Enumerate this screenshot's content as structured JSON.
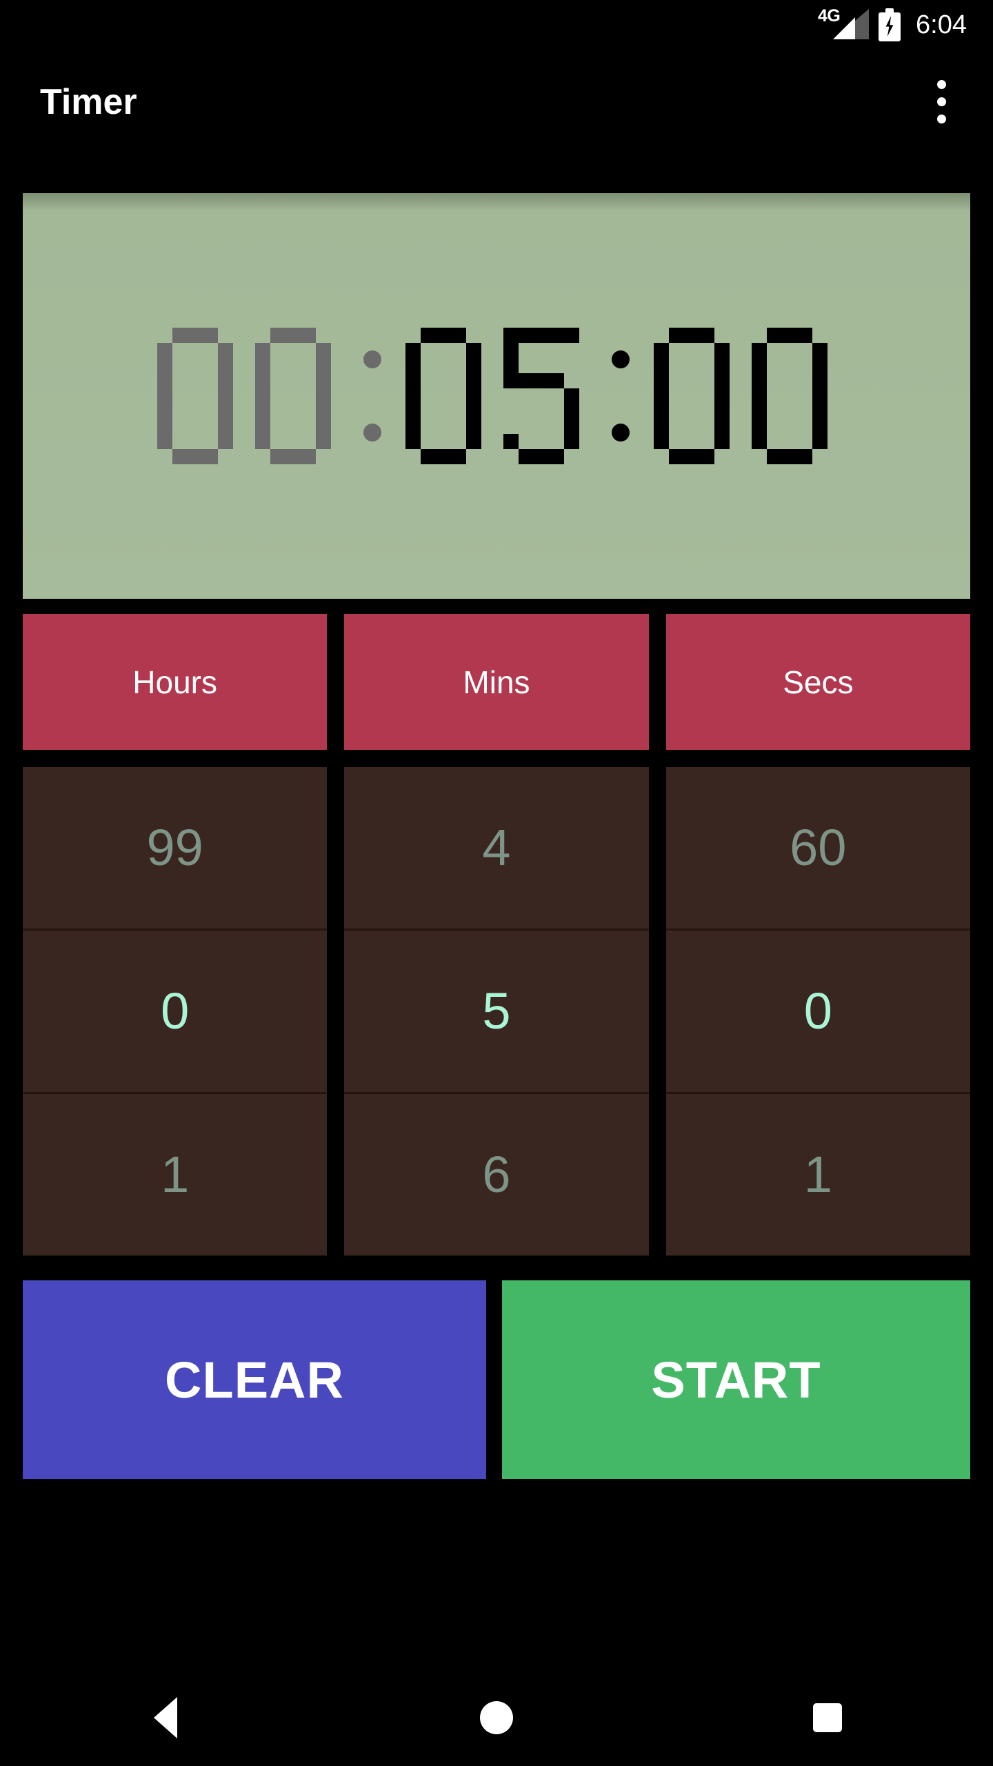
{
  "status_bar": {
    "network_label": "4G",
    "signal_icon": "signal-triangle-icon",
    "battery_icon": "battery-charging-icon",
    "time": "6:04"
  },
  "app_bar": {
    "title": "Timer",
    "overflow_icon": "more-vertical-icon"
  },
  "display": {
    "background_color": "#a6bb9b",
    "active_color": "#000000",
    "inactive_color": "#6b6b6b",
    "hours": "00",
    "mins": "05",
    "secs": "00",
    "separator": ":",
    "hours_active": false,
    "mins_active": true,
    "secs_active": true,
    "full_text": "00:05:00"
  },
  "units": {
    "accent_color": "#b1384f",
    "items": [
      {
        "label": "Hours"
      },
      {
        "label": "Mins"
      },
      {
        "label": "Secs"
      }
    ]
  },
  "pickers": {
    "cell_background": "#3a2620",
    "dim_color": "#7f9488",
    "selected_color": "#aaf5d5",
    "columns": [
      {
        "unit": "Hours",
        "prev": "99",
        "selected": "0",
        "next": "1"
      },
      {
        "unit": "Mins",
        "prev": "4",
        "selected": "5",
        "next": "6"
      },
      {
        "unit": "Secs",
        "prev": "60",
        "selected": "0",
        "next": "1"
      }
    ]
  },
  "actions": {
    "clear_label": "CLEAR",
    "clear_color": "#4a48bf",
    "start_label": "START",
    "start_color": "#45b868"
  },
  "nav_bar": {
    "back_icon": "back-triangle-icon",
    "home_icon": "home-circle-icon",
    "recents_icon": "recents-square-icon"
  }
}
